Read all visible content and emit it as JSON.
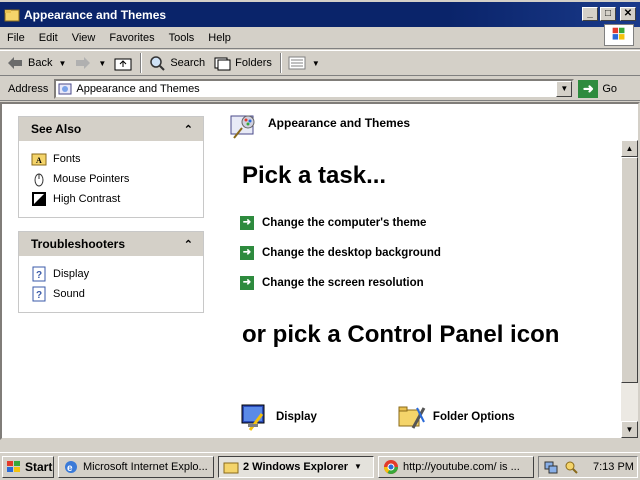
{
  "window": {
    "title": "Appearance and Themes",
    "minimize": "_",
    "maximize": "□",
    "close": "✕"
  },
  "menu": [
    "File",
    "Edit",
    "View",
    "Favorites",
    "Tools",
    "Help"
  ],
  "toolbar": {
    "back": "Back",
    "search": "Search",
    "folders": "Folders"
  },
  "address": {
    "label": "Address",
    "value": "Appearance and Themes",
    "go": "Go"
  },
  "see_also": {
    "title": "See Also",
    "items": [
      "Fonts",
      "Mouse Pointers",
      "High Contrast"
    ]
  },
  "troubleshooters": {
    "title": "Troubleshooters",
    "items": [
      "Display",
      "Sound"
    ]
  },
  "main": {
    "header": "Appearance and Themes",
    "pick_task": "Pick a task...",
    "tasks": [
      "Change the computer's theme",
      "Change the desktop background",
      "Change the screen resolution"
    ],
    "cp_title": "or pick a Control Panel icon",
    "cp_icons": [
      "Display",
      "Folder Options"
    ]
  },
  "taskbar": {
    "start": "Start",
    "tasks": [
      "Microsoft Internet Explo...",
      "2 Windows Explorer",
      "http://youtube.com/ is ..."
    ],
    "clock": "7:13 PM"
  },
  "colors": {
    "titlebar": "#0a246a",
    "chrome": "#d4d0c8",
    "task_arrow": "#2e8b3e"
  }
}
